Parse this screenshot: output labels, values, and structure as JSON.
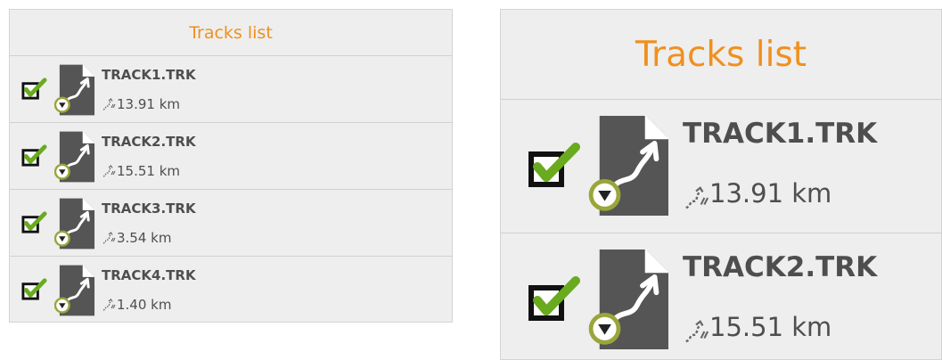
{
  "panels": [
    {
      "title": "Tracks list",
      "tracks": [
        {
          "name": "TRACK1.TRK",
          "distance": "13.91 km",
          "checked": true
        },
        {
          "name": "TRACK2.TRK",
          "distance": "15.51 km",
          "checked": true
        },
        {
          "name": "TRACK3.TRK",
          "distance": "3.54 km",
          "checked": true
        },
        {
          "name": "TRACK4.TRK",
          "distance": "1.40 km",
          "checked": true
        }
      ]
    },
    {
      "title": "Tracks list",
      "tracks": [
        {
          "name": "TRACK1.TRK",
          "distance": "13.91 km",
          "checked": true
        },
        {
          "name": "TRACK2.TRK",
          "distance": "15.51 km",
          "checked": true
        }
      ]
    }
  ],
  "icons": {
    "checkbox": "checkbox-checked-icon",
    "file": "track-file-icon",
    "distance": "track-distance-icon",
    "dropdown": "dropdown-arrow-icon"
  },
  "colors": {
    "title": "#f0901e",
    "check": "#6aaa1f",
    "file_icon": "#555555",
    "panel_bg": "#eeeeee",
    "text": "#4e4e4e"
  }
}
